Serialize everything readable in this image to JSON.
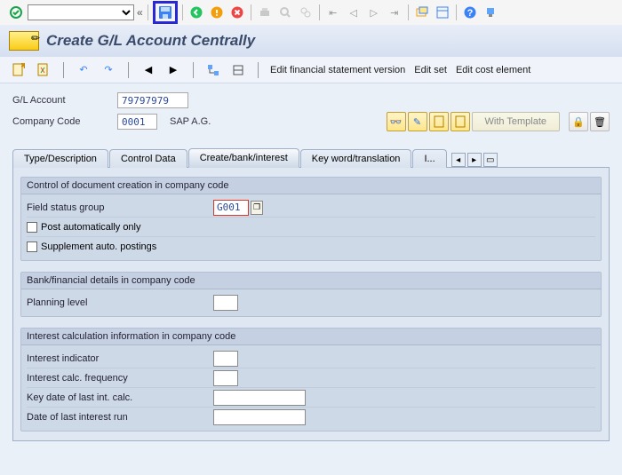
{
  "title": "Create G/L Account Centrally",
  "toolbar_links": {
    "edit_fs": "Edit financial statement version",
    "edit_set": "Edit set",
    "edit_ce": "Edit cost element"
  },
  "fields": {
    "gl_label": "G/L Account",
    "gl_value": "79797979",
    "cc_label": "Company Code",
    "cc_value": "0001",
    "cc_desc": "SAP A.G."
  },
  "btn_template": "With Template",
  "tabs": {
    "t1": "Type/Description",
    "t2": "Control Data",
    "t3": "Create/bank/interest",
    "t4": "Key word/translation",
    "t5": "I..."
  },
  "group1": {
    "title": "Control of document creation in company code",
    "fsg_label": "Field status group",
    "fsg_value": "G001",
    "chk1": "Post automatically only",
    "chk2": "Supplement auto. postings"
  },
  "group2": {
    "title": "Bank/financial details in company code",
    "plan_label": "Planning level"
  },
  "group3": {
    "title": "Interest calculation information in company code",
    "r1": "Interest indicator",
    "r2": "Interest calc. frequency",
    "r3": "Key date of last int. calc.",
    "r4": "Date of last interest run"
  }
}
